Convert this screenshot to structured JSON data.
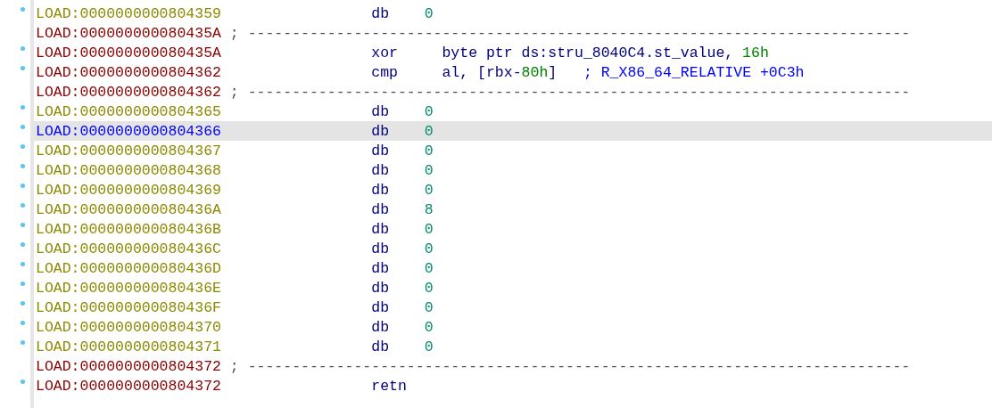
{
  "rows": [
    {
      "kind": "data",
      "address": "LOAD:0000000000804359",
      "mnemonic": "db",
      "operand": [
        {
          "kind": "number",
          "text": "0"
        }
      ],
      "selected": false
    },
    {
      "kind": "separator",
      "address": "LOAD:000000000080435A",
      "comment": "; ---------------------------------------------------------------------------",
      "selected": false
    },
    {
      "kind": "code",
      "address": "LOAD:000000000080435A",
      "mnemonic": "xor",
      "operand": [
        {
          "kind": "plain",
          "text": "byte ptr ds:stru_8040C4.st_value, "
        },
        {
          "kind": "number",
          "text": "16h"
        }
      ],
      "selected": false
    },
    {
      "kind": "code",
      "address": "LOAD:0000000000804362",
      "mnemonic": "cmp",
      "operand": [
        {
          "kind": "plain",
          "text": "al, [rbx-"
        },
        {
          "kind": "number",
          "text": "80h"
        },
        {
          "kind": "plain",
          "text": "]"
        },
        {
          "kind": "comment",
          "text": "; R_X86_64_RELATIVE +0C3h"
        }
      ],
      "selected": false
    },
    {
      "kind": "separator",
      "address": "LOAD:0000000000804362",
      "comment": "; ---------------------------------------------------------------------------",
      "selected": false
    },
    {
      "kind": "data",
      "address": "LOAD:0000000000804365",
      "mnemonic": "db",
      "operand": [
        {
          "kind": "number",
          "text": "0"
        }
      ],
      "selected": false
    },
    {
      "kind": "data",
      "address": "LOAD:0000000000804366",
      "mnemonic": "db",
      "operand": [
        {
          "kind": "number",
          "text": "0"
        }
      ],
      "selected": true
    },
    {
      "kind": "data",
      "address": "LOAD:0000000000804367",
      "mnemonic": "db",
      "operand": [
        {
          "kind": "number",
          "text": "0"
        }
      ],
      "selected": false
    },
    {
      "kind": "data",
      "address": "LOAD:0000000000804368",
      "mnemonic": "db",
      "operand": [
        {
          "kind": "number",
          "text": "0"
        }
      ],
      "selected": false
    },
    {
      "kind": "data",
      "address": "LOAD:0000000000804369",
      "mnemonic": "db",
      "operand": [
        {
          "kind": "number",
          "text": "0"
        }
      ],
      "selected": false
    },
    {
      "kind": "data",
      "address": "LOAD:000000000080436A",
      "mnemonic": "db",
      "operand": [
        {
          "kind": "number",
          "text": "8"
        }
      ],
      "selected": false
    },
    {
      "kind": "data",
      "address": "LOAD:000000000080436B",
      "mnemonic": "db",
      "operand": [
        {
          "kind": "number",
          "text": "0"
        }
      ],
      "selected": false
    },
    {
      "kind": "data",
      "address": "LOAD:000000000080436C",
      "mnemonic": "db",
      "operand": [
        {
          "kind": "number",
          "text": "0"
        }
      ],
      "selected": false
    },
    {
      "kind": "data",
      "address": "LOAD:000000000080436D",
      "mnemonic": "db",
      "operand": [
        {
          "kind": "number",
          "text": "0"
        }
      ],
      "selected": false
    },
    {
      "kind": "data",
      "address": "LOAD:000000000080436E",
      "mnemonic": "db",
      "operand": [
        {
          "kind": "number",
          "text": "0"
        }
      ],
      "selected": false
    },
    {
      "kind": "data",
      "address": "LOAD:000000000080436F",
      "mnemonic": "db",
      "operand": [
        {
          "kind": "number",
          "text": "0"
        }
      ],
      "selected": false
    },
    {
      "kind": "data",
      "address": "LOAD:0000000000804370",
      "mnemonic": "db",
      "operand": [
        {
          "kind": "number",
          "text": "0"
        }
      ],
      "selected": false
    },
    {
      "kind": "data",
      "address": "LOAD:0000000000804371",
      "mnemonic": "db",
      "operand": [
        {
          "kind": "number",
          "text": "0"
        }
      ],
      "selected": false
    },
    {
      "kind": "separator",
      "address": "LOAD:0000000000804372",
      "comment": "; ---------------------------------------------------------------------------",
      "selected": false
    },
    {
      "kind": "code",
      "address": "LOAD:0000000000804372",
      "mnemonic": "retn",
      "selected": false
    }
  ]
}
